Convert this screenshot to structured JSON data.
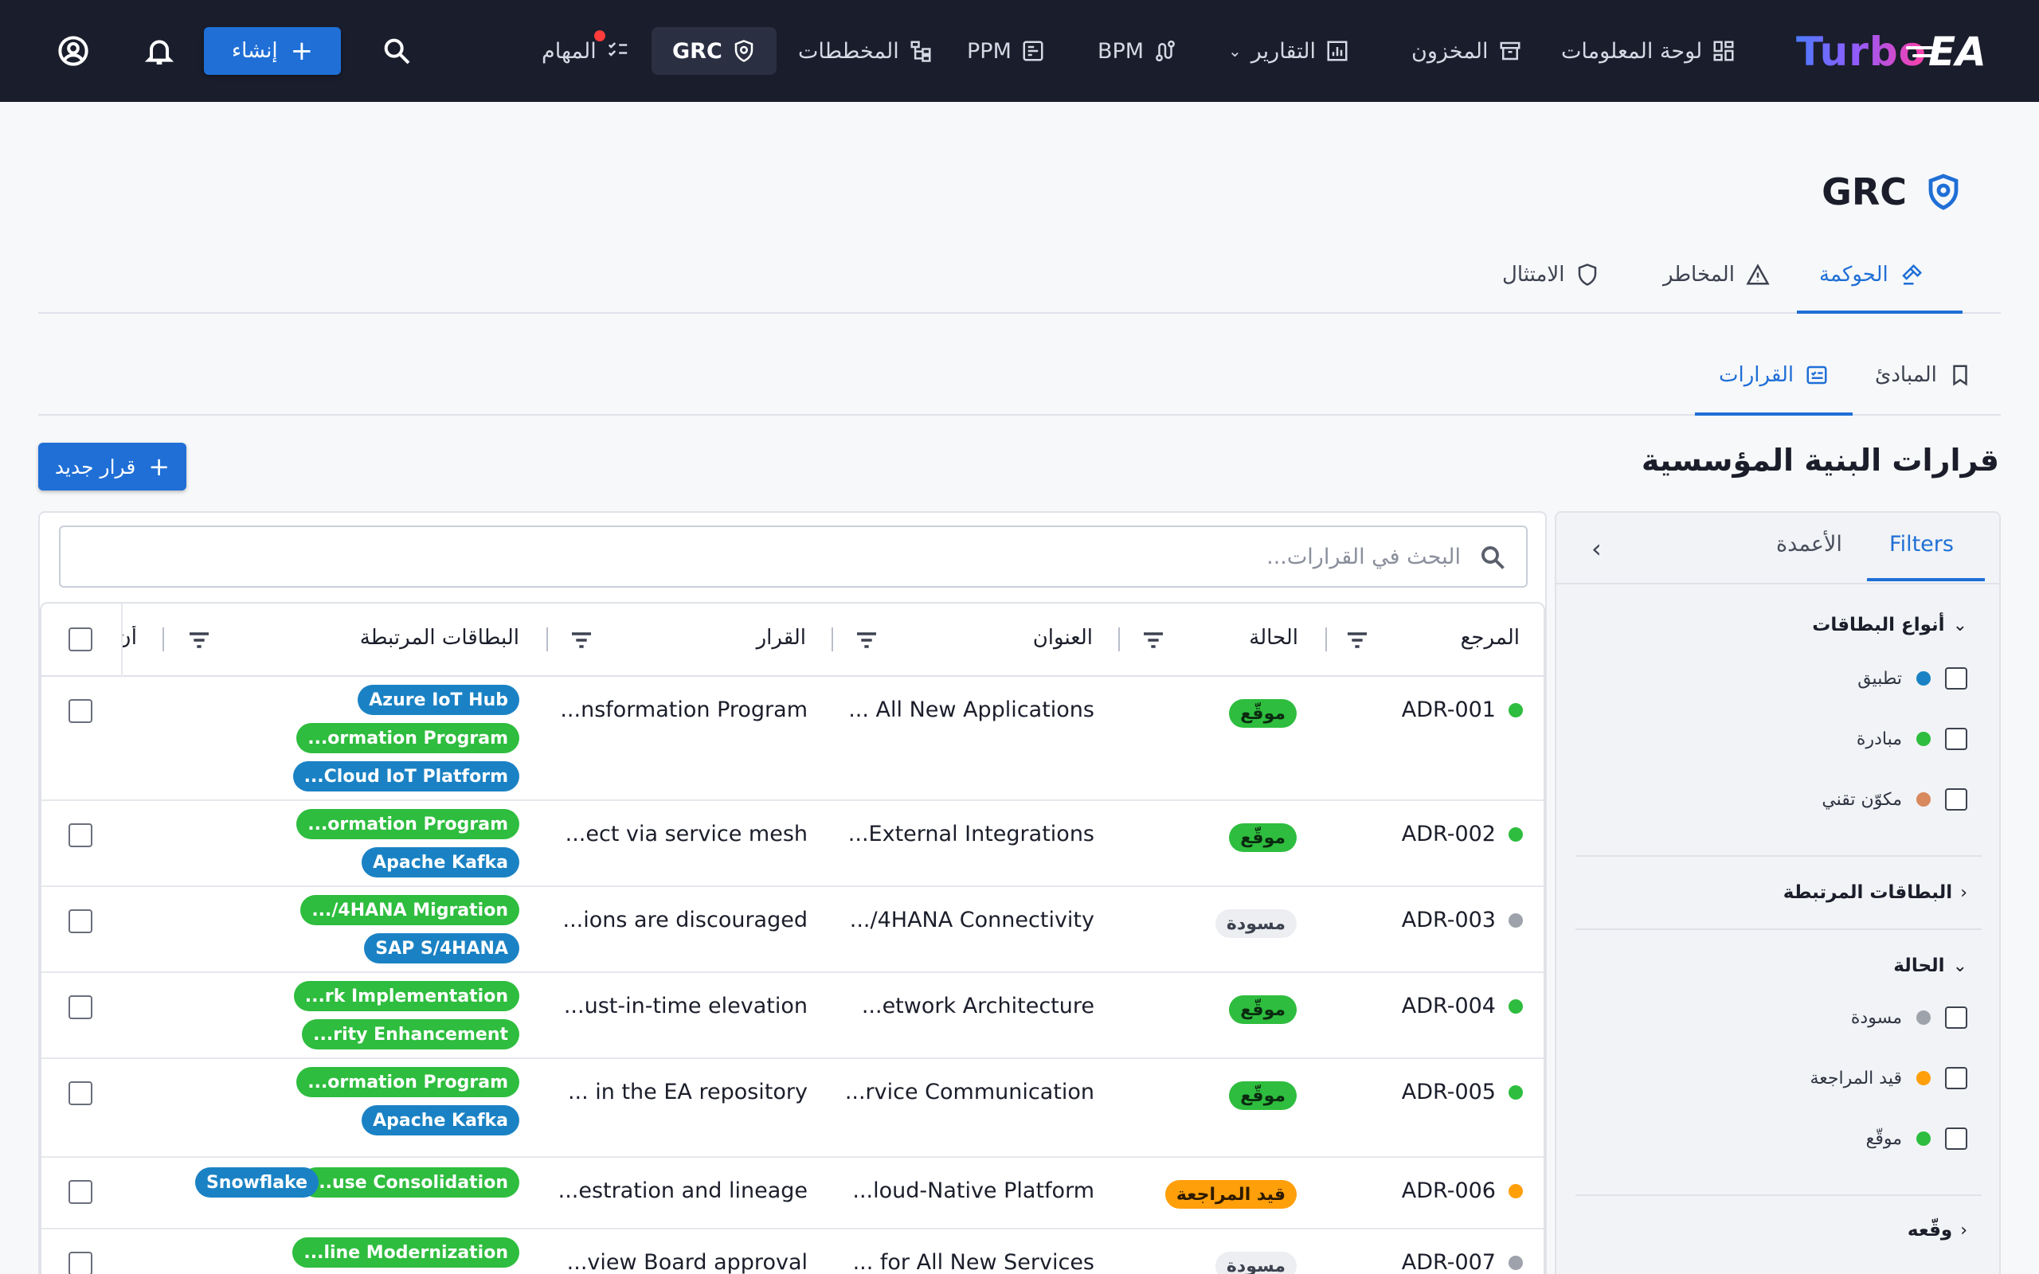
{
  "topbar": {
    "logo_turbo": "Turbo",
    "logo_ea": "EA",
    "nav": {
      "dashboard": "لوحة المعلومات",
      "inventory": "المخزون",
      "reports": "التقارير",
      "bpm": "BPM",
      "ppm": "PPM",
      "diagrams": "المخططات",
      "grc": "GRC",
      "tasks": "المهام"
    },
    "create_label": "إنشاء"
  },
  "page": {
    "title": "GRC",
    "tabs": {
      "governance": "الحوكمة",
      "risks": "المخاطر",
      "compliance": "الامتثال"
    },
    "subtabs": {
      "decisions": "القرارات",
      "principles": "المبادئ"
    },
    "section_title": "قرارات البنية المؤسسية",
    "new_decision": "قرار جديد"
  },
  "search": {
    "placeholder": "البحث في القرارات..."
  },
  "sidebar": {
    "tab_filters": "Filters",
    "tab_columns": "الأعمدة",
    "card_types": {
      "label": "أنواع البطاقات",
      "options": [
        {
          "label": "تطبيق",
          "color": "#1a82c4"
        },
        {
          "label": "مبادرة",
          "color": "#2ebd3e"
        },
        {
          "label": "مكوّن تقني",
          "color": "#d9895e"
        }
      ]
    },
    "linked_cards_label": "البطاقات المرتبطة",
    "status": {
      "label": "الحالة",
      "options": [
        {
          "label": "مسودة",
          "color": "#9ea2ab"
        },
        {
          "label": "قيد المراجعة",
          "color": "#ff9f0a"
        },
        {
          "label": "موقّع",
          "color": "#2ebd3e"
        }
      ]
    },
    "signed_by_label": "وقّعه"
  },
  "table": {
    "columns": {
      "ref": "المرجع",
      "status": "الحالة",
      "title": "العنوان",
      "decision": "القرار",
      "linked": "البطاقات المرتبطة",
      "more": "أن"
    },
    "rows": [
      {
        "ref": "ADR-001",
        "dot": "#2ebd3e",
        "status": "موقّع",
        "status_type": "signed",
        "title": "... All New Applications",
        "decision": "...nsformation Program",
        "chips": [
          {
            "text": "Azure IoT Hub",
            "kind": "blue"
          },
          {
            "text": "...ormation Program",
            "kind": "green"
          },
          {
            "text": "...Cloud IoT Platform",
            "kind": "blue"
          }
        ]
      },
      {
        "ref": "ADR-002",
        "dot": "#2ebd3e",
        "status": "موقّع",
        "status_type": "signed",
        "title": "...External Integrations",
        "decision": "...ect via service mesh",
        "chips": [
          {
            "text": "...ormation Program",
            "kind": "green"
          },
          {
            "text": "Apache Kafka",
            "kind": "blue"
          }
        ]
      },
      {
        "ref": "ADR-003",
        "dot": "#9ea2ab",
        "status": "مسودة",
        "status_type": "draft",
        "title": ".../4HANA Connectivity",
        "decision": "...ions are discouraged",
        "chips": [
          {
            "text": ".../4HANA Migration",
            "kind": "green"
          },
          {
            "text": "SAP S/4HANA",
            "kind": "blue"
          }
        ]
      },
      {
        "ref": "ADR-004",
        "dot": "#2ebd3e",
        "status": "موقّع",
        "status_type": "signed",
        "title": "...etwork Architecture",
        "decision": "...ust-in-time elevation",
        "chips": [
          {
            "text": "...rk Implementation",
            "kind": "green"
          },
          {
            "text": "...rity Enhancement",
            "kind": "green"
          }
        ]
      },
      {
        "ref": "ADR-005",
        "dot": "#2ebd3e",
        "status": "موقّع",
        "status_type": "signed",
        "title": "...rvice Communication",
        "decision": "... in the EA repository",
        "chips": [
          {
            "text": "...ormation Program",
            "kind": "green"
          },
          {
            "text": "Apache Kafka",
            "kind": "blue"
          }
        ]
      },
      {
        "ref": "ADR-006",
        "dot": "#ff9f0a",
        "status": "قيد المراجعة",
        "status_type": "review",
        "title": "...loud-Native Platform",
        "decision": "...estration and lineage",
        "chips": [
          {
            "text": "...use Consolidation",
            "kind": "green"
          },
          {
            "text": "Snowflake",
            "kind": "blue"
          }
        ]
      },
      {
        "ref": "ADR-007",
        "dot": "#9ea2ab",
        "status": "مسودة",
        "status_type": "draft",
        "title": "... for All New Services",
        "decision": "...view Board approval",
        "chips": [
          {
            "text": "...line Modernization",
            "kind": "green"
          }
        ]
      }
    ]
  }
}
